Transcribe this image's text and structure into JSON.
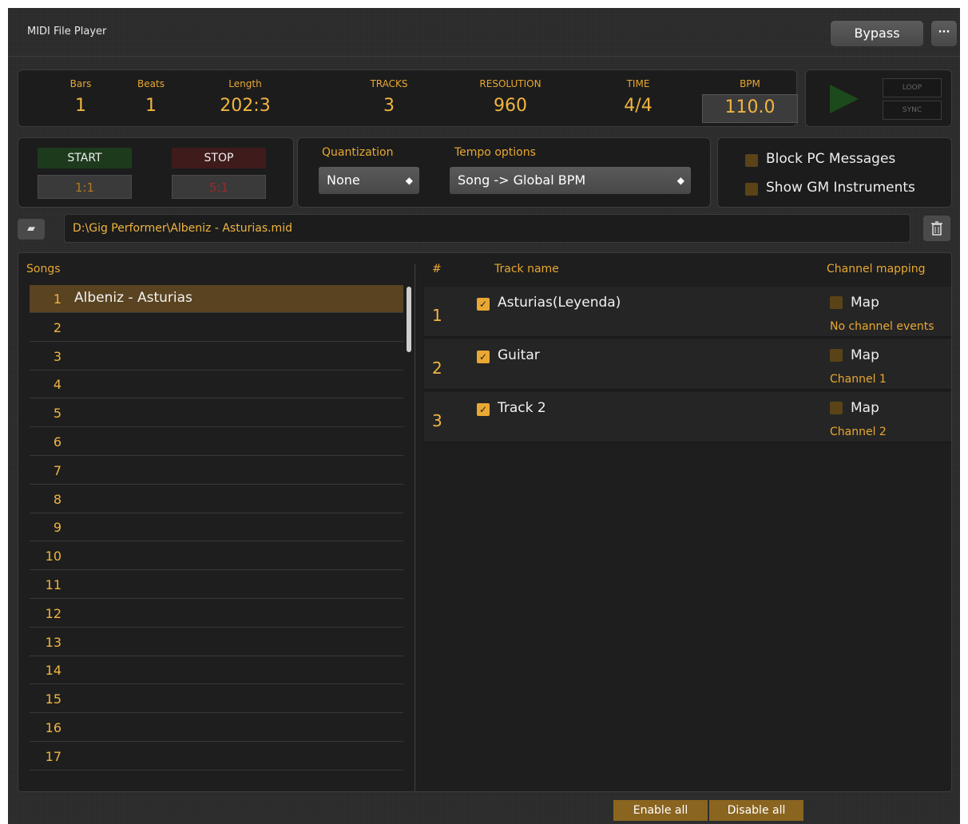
{
  "window": {
    "title": "MIDI File Player",
    "bypass_label": "Bypass",
    "more_label": "···"
  },
  "stats": {
    "bars": {
      "label": "Bars",
      "value": "1"
    },
    "beats": {
      "label": "Beats",
      "value": "1"
    },
    "length": {
      "label": "Length",
      "value": "202:3"
    },
    "tracks": {
      "label": "TRACKS",
      "value": "3"
    },
    "resolution": {
      "label": "RESOLUTION",
      "value": "960"
    },
    "time": {
      "label": "TIME",
      "value": "4/4"
    },
    "bpm": {
      "label": "BPM",
      "value": "110.0"
    }
  },
  "transport": {
    "loop_label": "LOOP",
    "sync_label": "SYNC",
    "play_color": "#1c4a1c"
  },
  "range": {
    "start_label": "START",
    "start_value": "1:1",
    "start_value_color": "#b07a20",
    "stop_label": "STOP",
    "stop_value": "5:1",
    "stop_value_color": "#9a2a2a"
  },
  "quantization": {
    "label": "Quantization",
    "value": "None"
  },
  "tempo": {
    "label": "Tempo options",
    "value": "Song -> Global BPM"
  },
  "options": {
    "block_pc": "Block PC Messages",
    "show_gm": "Show GM Instruments"
  },
  "file": {
    "path": "D:\\Gig Performer\\Albeniz - Asturias.mid"
  },
  "songs": {
    "header": "Songs",
    "items": [
      {
        "num": "1",
        "name": "Albeniz - Asturias"
      },
      {
        "num": "2",
        "name": ""
      },
      {
        "num": "3",
        "name": ""
      },
      {
        "num": "4",
        "name": ""
      },
      {
        "num": "5",
        "name": ""
      },
      {
        "num": "6",
        "name": ""
      },
      {
        "num": "7",
        "name": ""
      },
      {
        "num": "8",
        "name": ""
      },
      {
        "num": "9",
        "name": ""
      },
      {
        "num": "10",
        "name": ""
      },
      {
        "num": "11",
        "name": ""
      },
      {
        "num": "12",
        "name": ""
      },
      {
        "num": "13",
        "name": ""
      },
      {
        "num": "14",
        "name": ""
      },
      {
        "num": "15",
        "name": ""
      },
      {
        "num": "16",
        "name": ""
      },
      {
        "num": "17",
        "name": ""
      }
    ]
  },
  "tracks": {
    "headers": {
      "num": "#",
      "name": "Track name",
      "mapping": "Channel mapping"
    },
    "map_label": "Map",
    "items": [
      {
        "num": "1",
        "name": "Asturias(Leyenda)",
        "channel": "No channel events"
      },
      {
        "num": "2",
        "name": "Guitar",
        "channel": "Channel 1"
      },
      {
        "num": "3",
        "name": "Track 2",
        "channel": "Channel 2"
      }
    ]
  },
  "footer": {
    "enable_all": "Enable all",
    "disable_all": "Disable all"
  },
  "colors": {
    "accent": "#e8a832",
    "selected_row": "#5a4320",
    "checkbox_off": "#5a4316"
  }
}
